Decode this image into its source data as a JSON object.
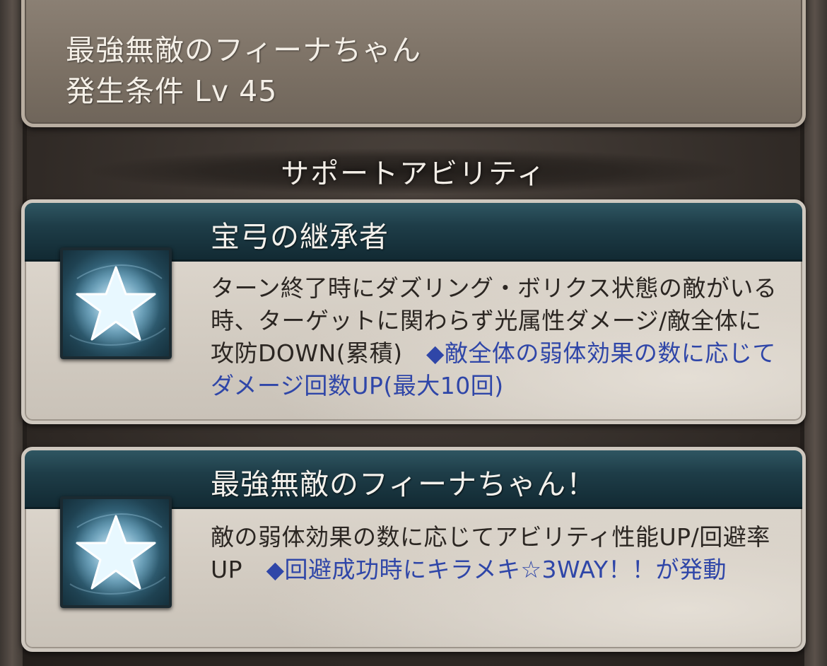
{
  "header": {
    "title": "最強無敵のフィーナちゃん",
    "condition": "発生条件 Lv 45"
  },
  "section": {
    "heading": "サポートアビリティ"
  },
  "abilities": [
    {
      "name": "宝弓の継承者",
      "icon": "star-icon",
      "description": "ターン終了時にダズリング・ボリクス状態の敵がいる時、ターゲットに関わらず光属性ダメージ/敵全体に攻防DOWN(累積)　",
      "highlight": "◆敵全体の弱体効果の数に応じてダメージ回数UP(最大10回)"
    },
    {
      "name": "最強無敵のフィーナちゃん！",
      "icon": "star-icon",
      "description": "敵の弱体効果の数に応じてアビリティ性能UP/回避率UP　",
      "highlight": "◆回避成功時にキラメキ☆3WAY！！が発動"
    }
  ],
  "colors": {
    "highlight_text": "#2f46a8",
    "band": "#1e3d48"
  }
}
